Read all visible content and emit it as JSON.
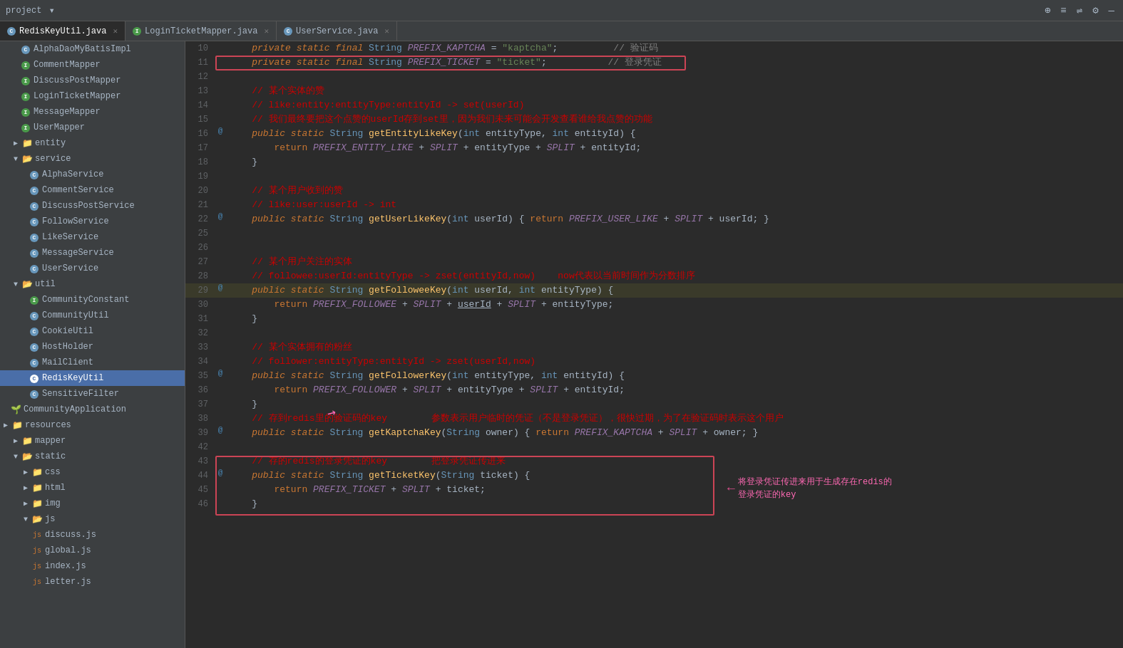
{
  "topbar": {
    "project_label": "project",
    "dropdown_icon": "▾",
    "icons": [
      "⊕",
      "≡",
      "⇌",
      "⚙",
      "—"
    ]
  },
  "tabs": [
    {
      "id": "redis",
      "type": "c",
      "label": "RedisKeyUtil.java",
      "active": true
    },
    {
      "id": "login",
      "type": "i",
      "label": "LoginTicketMapper.java",
      "active": false
    },
    {
      "id": "user",
      "type": "c",
      "label": "UserService.java",
      "active": false
    }
  ],
  "sidebar": {
    "items": [
      {
        "id": "alpha-dao",
        "level": 2,
        "icon": "c",
        "label": "AlphaDaoMyBatisImpl",
        "selected": false
      },
      {
        "id": "comment-mapper",
        "level": 2,
        "icon": "i",
        "label": "CommentMapper",
        "selected": false
      },
      {
        "id": "discuss-mapper",
        "level": 2,
        "icon": "i",
        "label": "DiscussPostMapper",
        "selected": false
      },
      {
        "id": "login-mapper",
        "level": 2,
        "icon": "i",
        "label": "LoginTicketMapper",
        "selected": false
      },
      {
        "id": "message-mapper",
        "level": 2,
        "icon": "i",
        "label": "MessageMapper",
        "selected": false
      },
      {
        "id": "user-mapper",
        "level": 2,
        "icon": "i",
        "label": "UserMapper",
        "selected": false
      },
      {
        "id": "entity-folder",
        "level": 1,
        "icon": "folder-arrow",
        "label": "entity",
        "selected": false
      },
      {
        "id": "service-folder",
        "level": 1,
        "icon": "folder-open",
        "label": "service",
        "selected": false
      },
      {
        "id": "alpha-service",
        "level": 2,
        "icon": "c",
        "label": "AlphaService",
        "selected": false
      },
      {
        "id": "comment-service",
        "level": 2,
        "icon": "c",
        "label": "CommentService",
        "selected": false
      },
      {
        "id": "discuss-service",
        "level": 2,
        "icon": "c",
        "label": "DiscussPostService",
        "selected": false
      },
      {
        "id": "follow-service",
        "level": 2,
        "icon": "c",
        "label": "FollowService",
        "selected": false
      },
      {
        "id": "like-service",
        "level": 2,
        "icon": "c",
        "label": "LikeService",
        "selected": false
      },
      {
        "id": "message-service",
        "level": 2,
        "icon": "c",
        "label": "MessageService",
        "selected": false
      },
      {
        "id": "user-service",
        "level": 2,
        "icon": "c",
        "label": "UserService",
        "selected": false
      },
      {
        "id": "util-folder",
        "level": 1,
        "icon": "folder-open",
        "label": "util",
        "selected": false
      },
      {
        "id": "community-constant",
        "level": 2,
        "icon": "i",
        "label": "CommunityConstant",
        "selected": false
      },
      {
        "id": "community-util",
        "level": 2,
        "icon": "c",
        "label": "CommunityUtil",
        "selected": false
      },
      {
        "id": "cookie-util",
        "level": 2,
        "icon": "c",
        "label": "CookieUtil",
        "selected": false
      },
      {
        "id": "host-holder",
        "level": 2,
        "icon": "c",
        "label": "HostHolder",
        "selected": false
      },
      {
        "id": "mail-client",
        "level": 2,
        "icon": "c",
        "label": "MailClient",
        "selected": false
      },
      {
        "id": "redis-key-util",
        "level": 2,
        "icon": "c",
        "label": "RedisKeyUtil",
        "selected": true
      },
      {
        "id": "sensitive-filter",
        "level": 2,
        "icon": "c",
        "label": "SensitiveFilter",
        "selected": false
      },
      {
        "id": "community-app",
        "level": 1,
        "icon": "spring",
        "label": "CommunityApplication",
        "selected": false
      },
      {
        "id": "resources-folder",
        "level": 0,
        "icon": "folder-arrow",
        "label": "resources",
        "selected": false
      },
      {
        "id": "mapper-folder",
        "level": 1,
        "icon": "folder-arrow",
        "label": "mapper",
        "selected": false
      },
      {
        "id": "static-folder",
        "level": 1,
        "icon": "folder-open",
        "label": "static",
        "selected": false
      },
      {
        "id": "css-folder",
        "level": 2,
        "icon": "folder-arrow",
        "label": "css",
        "selected": false
      },
      {
        "id": "html-folder",
        "level": 2,
        "icon": "folder-arrow",
        "label": "html",
        "selected": false
      },
      {
        "id": "img-folder",
        "level": 2,
        "icon": "folder-arrow",
        "label": "img",
        "selected": false
      },
      {
        "id": "js-folder",
        "level": 2,
        "icon": "folder-open",
        "label": "js",
        "selected": false
      },
      {
        "id": "discuss-js",
        "level": 3,
        "icon": "js",
        "label": "discuss.js",
        "selected": false
      },
      {
        "id": "global-js",
        "level": 3,
        "icon": "js",
        "label": "global.js",
        "selected": false
      },
      {
        "id": "index-js",
        "level": 3,
        "icon": "js",
        "label": "index.js",
        "selected": false
      },
      {
        "id": "letter-js",
        "level": 3,
        "icon": "js",
        "label": "letter.js",
        "selected": false
      }
    ]
  },
  "code": {
    "lines": [
      {
        "num": 10,
        "marker": "",
        "content": "    private static final String PREFIX_KAPTCHA = \"kaptcha\";",
        "comment": "// 验证码",
        "box": false
      },
      {
        "num": 11,
        "marker": "",
        "content": "    private static final String PREFIX_TICKET = \"ticket\";",
        "comment": "// 登录凭证",
        "box": true
      },
      {
        "num": 12,
        "marker": "",
        "content": "",
        "comment": ""
      },
      {
        "num": 13,
        "marker": "",
        "content": "    // 某个实体的赞",
        "comment": ""
      },
      {
        "num": 14,
        "marker": "",
        "content": "    // like:entity:entityType:entityId -> set(userId)",
        "comment": ""
      },
      {
        "num": 15,
        "marker": "",
        "content": "    // 我们最终要把这个点赞的userId存到set里，因为我们未来可能会开发查看谁给我点赞的功能",
        "comment": ""
      },
      {
        "num": 16,
        "marker": "@",
        "content": "    public static String getEntityLikeKey(int entityType, int entityId) {",
        "comment": ""
      },
      {
        "num": 17,
        "marker": "",
        "content": "        return PREFIX_ENTITY_LIKE + SPLIT + entityType + SPLIT + entityId;",
        "comment": ""
      },
      {
        "num": 18,
        "marker": "",
        "content": "    }",
        "comment": ""
      },
      {
        "num": 19,
        "marker": "",
        "content": "",
        "comment": ""
      },
      {
        "num": 20,
        "marker": "",
        "content": "    // 某个用户收到的赞",
        "comment": ""
      },
      {
        "num": 21,
        "marker": "",
        "content": "    // like:user:userId -> int",
        "comment": ""
      },
      {
        "num": 22,
        "marker": "@",
        "content": "    public static String getUserLikeKey(int userId) { return PREFIX_USER_LIKE + SPLIT + userId; }",
        "comment": ""
      },
      {
        "num": 25,
        "marker": "",
        "content": "",
        "comment": ""
      },
      {
        "num": 26,
        "marker": "",
        "content": "",
        "comment": ""
      },
      {
        "num": 27,
        "marker": "",
        "content": "    // 某个用户关注的实体",
        "comment": ""
      },
      {
        "num": 28,
        "marker": "",
        "content": "    // followee:userId:entityType -> zset(entityId,now)    now代表以当前时间作为分数排序",
        "comment": ""
      },
      {
        "num": 29,
        "marker": "@",
        "content": "    public static String getFolloweeKey(int userId, int entityType) {",
        "comment": "",
        "highlight": true
      },
      {
        "num": 30,
        "marker": "",
        "content": "        return PREFIX_FOLLOWEE + SPLIT + userId + SPLIT + entityType;",
        "comment": ""
      },
      {
        "num": 31,
        "marker": "",
        "content": "    }",
        "comment": ""
      },
      {
        "num": 32,
        "marker": "",
        "content": "",
        "comment": ""
      },
      {
        "num": 33,
        "marker": "",
        "content": "    // 某个实体拥有的粉丝",
        "comment": ""
      },
      {
        "num": 34,
        "marker": "",
        "content": "    // follower:entityType:entityId -> zset(userId,now)",
        "comment": ""
      },
      {
        "num": 35,
        "marker": "@",
        "content": "    public static String getFollowerKey(int entityType, int entityId) {",
        "comment": ""
      },
      {
        "num": 36,
        "marker": "",
        "content": "        return PREFIX_FOLLOWER + SPLIT + entityType + SPLIT + entityId;",
        "comment": ""
      },
      {
        "num": 37,
        "marker": "",
        "content": "    }",
        "comment": ""
      },
      {
        "num": 38,
        "marker": "",
        "content": "    // 存到redis里的验证码的key        参数表示用户临时的凭证（不是登录凭证），很快过期，为了在验证码时表示这个用户",
        "comment": ""
      },
      {
        "num": 39,
        "marker": "@",
        "content": "    public static String getKaptchaKey(String owner) { return PREFIX_KAPTCHA + SPLIT + owner; }",
        "comment": ""
      },
      {
        "num": 42,
        "marker": "",
        "content": "",
        "comment": ""
      },
      {
        "num": 43,
        "marker": "",
        "content": "    // 存的redis的登录凭证的key        把登录凭证传进来",
        "comment": ""
      },
      {
        "num": 44,
        "marker": "@",
        "content": "    public static String getTicketKey(String ticket) {",
        "comment": ""
      },
      {
        "num": 45,
        "marker": "",
        "content": "        return PREFIX_TICKET + SPLIT + ticket;",
        "comment": ""
      },
      {
        "num": 46,
        "marker": "",
        "content": "    }",
        "comment": ""
      }
    ],
    "annotation1": {
      "text": "// 将登录凭证传进来用于生成存在redis的",
      "text2": "登录凭证的key",
      "arrow": "←"
    }
  }
}
